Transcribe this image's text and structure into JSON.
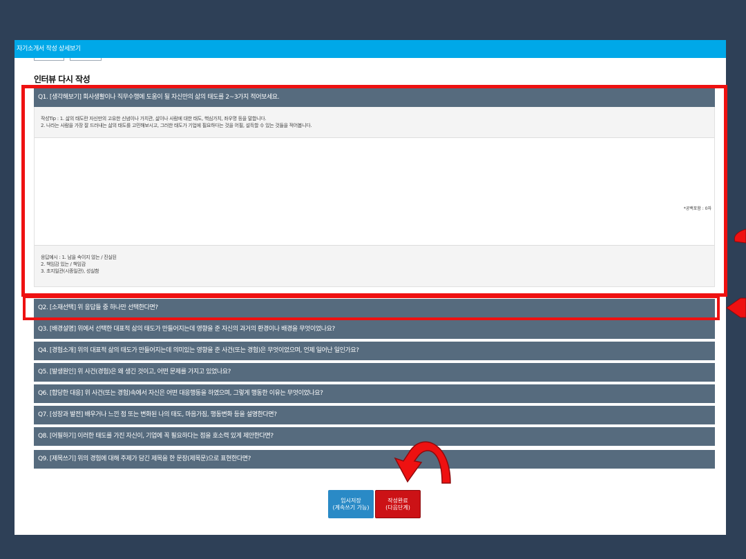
{
  "window": {
    "title": "자기소개서 작성 상세보기"
  },
  "section": {
    "title": "인터뷰 다시 작성"
  },
  "q1": {
    "question": "Q1. [생각해보기] 회사생활이나 직무수행에 도움이 될 자신만의 삶의 태도를 2~3가지 적어보세요.",
    "tip_line1": "작성Tip : 1. 삶의 태도란 자신만의 고유한 신념이나 가치관, 삶이나 사람에 대한 태도, 핵심가치, 좌우명 등을 말합니다.",
    "tip_line2": "2. 나라는 사람을 가장 잘 드러내는 삶의 태도를 고민해보시고, 그러한 태도가 기업에 필요하다는 것을 어필, 설득할 수 있는 것들을 적어봅니다.",
    "answer_value": "",
    "char_count": "*공백포함 : 0자",
    "example_line1": "응답예시 : 1. 남을 속이지 않는 / 진실된",
    "example_line2": "2. 책임감 있는 / 책임감",
    "example_line3": "3. 초지일관(시종일관), 성실함"
  },
  "questions": [
    "Q2. [소재선택] 위 응답들 중 하나만 선택한다면?",
    "Q3. [배경설명] 위에서 선택한 대표적 삶의 태도가 만들어지는데 영향을 준 자신의 과거의 환경이나 배경을 무엇이었나요?",
    "Q4. [경험소개] 위의 대표적 삶의 태도가 만들어지는데 의미있는 영향을 준 사건(또는 경험)은 무엇이었으며, 언제 일어난 일인가요?",
    "Q5. [발생원인] 위 사건(경험)은 왜 생긴 것이고, 어떤 문제를 가지고 있었나요?",
    "Q6. [합당한 대응] 위 사건(또는 경험)속에서 자신은 어떤 대응행동을 하였으며, 그렇게 행동한 이유는 무엇이었나요?",
    "Q7. [성장과 발전] 배우거나 느낀 점 또는 변화된 나의 태도, 마음가짐, 행동변화 등을 설명한다면?",
    "Q8. [어필하기] 이러한 태도를 가진 자신이, 기업에 꼭 필요하다는 점을 호소력 있게 제안한다면?",
    "Q9. [제목쓰기] 위의 경험에 대해 주제가 담긴 제목을 한 문장(제목문)으로 표현한다면?"
  ],
  "buttons": {
    "save_line1": "임시저장",
    "save_line2": "(계속쓰기 가능)",
    "done_line1": "작성완료",
    "done_line2": "(다음단계)"
  },
  "colors": {
    "background": "#2e4057",
    "titlebar": "#00a8e8",
    "question_bar": "#566b7e",
    "save_button": "#2a8ac6",
    "done_button": "#cc1216",
    "highlight": "#ee1111"
  }
}
